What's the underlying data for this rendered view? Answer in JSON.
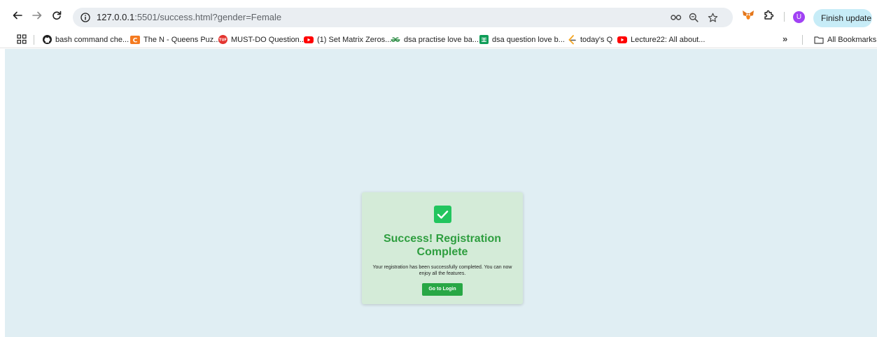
{
  "browser": {
    "url_host": "127.0.0.1",
    "url_rest": ":5501/success.html?gender=Female",
    "avatar_letter": "U",
    "finish_update_label": "Finish update",
    "finish_update_menu": "⋮"
  },
  "bookmarks": {
    "items": [
      {
        "label": "bash command che...",
        "icon": "github-icon"
      },
      {
        "label": "The N - Queens Puz...",
        "icon": "codechef-icon"
      },
      {
        "label": "MUST-DO Question...",
        "icon": "gfg-icon"
      },
      {
        "label": "(1) Set Matrix Zeros...",
        "icon": "youtube-icon"
      },
      {
        "label": "dsa practise love ba...",
        "icon": "geeksforgeeks-icon"
      },
      {
        "label": "dsa question love b...",
        "icon": "sheets-icon"
      },
      {
        "label": "today's Q",
        "icon": "leetcode-icon"
      },
      {
        "label": "Lecture22: All about...",
        "icon": "youtube-icon"
      }
    ],
    "more_label": "»",
    "all_bookmarks_label": "All Bookmarks"
  },
  "page": {
    "title": "Success! Registration Complete",
    "message": "Your registration has been successfully completed. You can now enjoy all the features.",
    "button_label": "Go to Login"
  },
  "colors": {
    "page_bg": "#e0eef3",
    "card_bg": "#d4ebd8",
    "title_green": "#2e9e3f",
    "button_green": "#28a745",
    "check_green": "#22c55e",
    "finish_update_bg": "#c7ecf7"
  }
}
